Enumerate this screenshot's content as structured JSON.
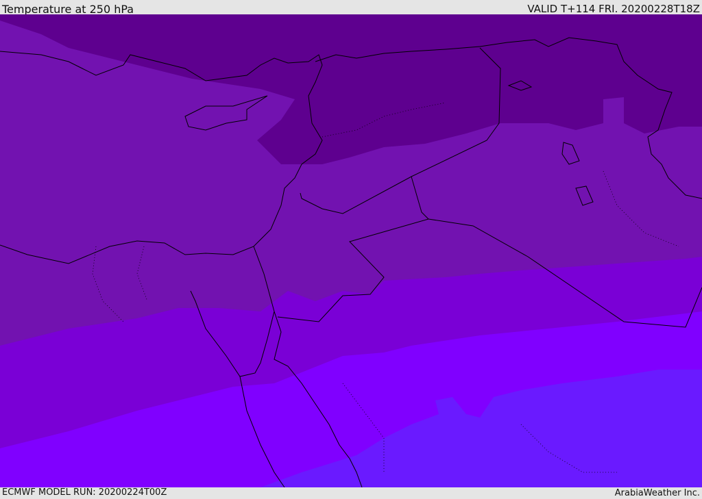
{
  "header": {
    "title": "Temperature at 250 hPa",
    "valid_time": "VALID T+114 FRI. 20200228T18Z"
  },
  "footer": {
    "model_run": "ECMWF MODEL RUN: 20200224T00Z",
    "credit": "ArabiaWeather Inc."
  },
  "colors": {
    "band_coldest": "#5e008f",
    "band_2": "#7212b0",
    "band_3": "#7a00d6",
    "band_4": "#8000ff",
    "band_warmest": "#6a1aff",
    "coastline": "#000000"
  }
}
